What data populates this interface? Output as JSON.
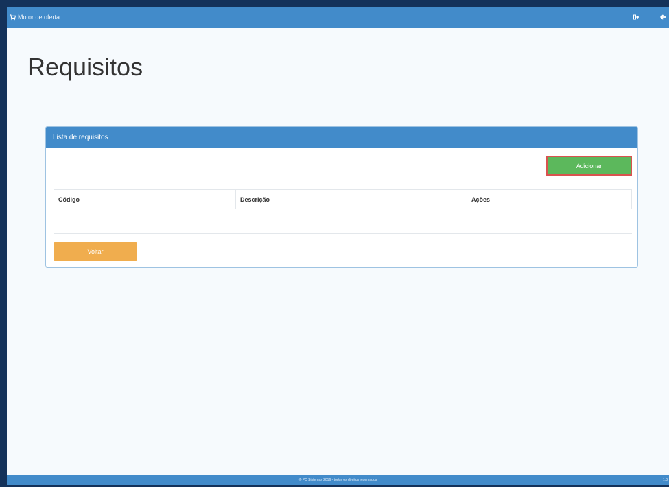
{
  "topbar": {
    "brand": "Motor de oferta",
    "actions": [
      {
        "icon": "sign-out-icon"
      },
      {
        "icon": "arrow-left-icon"
      }
    ]
  },
  "page": {
    "title": "Requisitos"
  },
  "panel": {
    "heading": "Lista de requisitos",
    "add_button": "Adicionar",
    "table": {
      "columns": [
        "Código",
        "Descrição",
        "Ações"
      ],
      "rows": []
    },
    "back_button": "Voltar"
  },
  "footer": {
    "copyright": "© PC Sistemas 2016 - todos os direitos reservados",
    "version": "1.0"
  },
  "colors": {
    "primary": "#428bca",
    "success": "#5cb85c",
    "warning": "#f0ad4e",
    "highlight_border": "#d9534f",
    "frame": "#14325a",
    "background": "#f6fafd"
  }
}
